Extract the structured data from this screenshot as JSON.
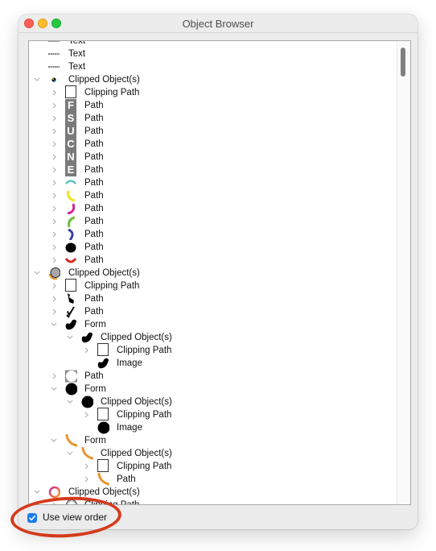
{
  "window": {
    "title": "Object Browser"
  },
  "tree": [
    {
      "level": 0,
      "expander": "none",
      "icon": "text-dash-icon",
      "label": "Text",
      "partial": true
    },
    {
      "level": 0,
      "expander": "none",
      "icon": "text-dash-icon",
      "label": "Text"
    },
    {
      "level": 0,
      "expander": "none",
      "icon": "text-dash-icon",
      "label": "Text"
    },
    {
      "level": 0,
      "expander": "expanded",
      "icon": "colored-dot-icon",
      "label": "Clipped Object(s)"
    },
    {
      "level": 1,
      "expander": "collapsed",
      "icon": "clipping-rect-icon",
      "label": "Clipping Path"
    },
    {
      "level": 1,
      "expander": "collapsed",
      "icon": "letter-f-icon",
      "letter": "F",
      "label": "Path"
    },
    {
      "level": 1,
      "expander": "collapsed",
      "icon": "letter-s-icon",
      "letter": "S",
      "label": "Path"
    },
    {
      "level": 1,
      "expander": "collapsed",
      "icon": "letter-u-icon",
      "letter": "U",
      "label": "Path"
    },
    {
      "level": 1,
      "expander": "collapsed",
      "icon": "letter-c-icon",
      "letter": "C",
      "label": "Path"
    },
    {
      "level": 1,
      "expander": "collapsed",
      "icon": "letter-n-icon",
      "letter": "N",
      "label": "Path"
    },
    {
      "level": 1,
      "expander": "collapsed",
      "icon": "letter-e-icon",
      "letter": "E",
      "label": "Path"
    },
    {
      "level": 1,
      "expander": "collapsed",
      "icon": "arc-teal-icon",
      "color": "#5bc4c0",
      "label": "Path"
    },
    {
      "level": 1,
      "expander": "collapsed",
      "icon": "arc-yellow-icon",
      "color": "#f2e21c",
      "label": "Path"
    },
    {
      "level": 1,
      "expander": "collapsed",
      "icon": "arc-magenta-icon",
      "color": "#d0249a",
      "label": "Path"
    },
    {
      "level": 1,
      "expander": "collapsed",
      "icon": "arc-green-icon",
      "color": "#6cbf3c",
      "label": "Path"
    },
    {
      "level": 1,
      "expander": "collapsed",
      "icon": "arc-blue-icon",
      "color": "#3a3f9e",
      "label": "Path"
    },
    {
      "level": 1,
      "expander": "collapsed",
      "icon": "black-blob-icon",
      "label": "Path"
    },
    {
      "level": 1,
      "expander": "collapsed",
      "icon": "arc-red-icon",
      "color": "#d42a2a",
      "label": "Path"
    },
    {
      "level": 0,
      "expander": "expanded",
      "icon": "gray-circle-icon",
      "label": "Clipped Object(s)"
    },
    {
      "level": 1,
      "expander": "collapsed",
      "icon": "clipping-rect-icon",
      "label": "Clipping Path"
    },
    {
      "level": 1,
      "expander": "collapsed",
      "icon": "brush-stroke-icon",
      "label": "Path"
    },
    {
      "level": 1,
      "expander": "collapsed",
      "icon": "check-stroke-icon",
      "label": "Path"
    },
    {
      "level": 1,
      "expander": "expanded",
      "icon": "brush-blob-icon",
      "label": "Form"
    },
    {
      "level": 2,
      "expander": "expanded",
      "icon": "brush-blob-icon",
      "label": "Clipped Object(s)"
    },
    {
      "level": 3,
      "expander": "collapsed",
      "icon": "clipping-rect-icon",
      "label": "Clipping Path"
    },
    {
      "level": 3,
      "expander": "none",
      "icon": "brush-blob-icon",
      "label": "Image"
    },
    {
      "level": 1,
      "expander": "collapsed",
      "icon": "white-circle-icon",
      "label": "Path"
    },
    {
      "level": 1,
      "expander": "expanded",
      "icon": "black-circle-icon",
      "label": "Form"
    },
    {
      "level": 2,
      "expander": "expanded",
      "icon": "black-circle-icon",
      "label": "Clipped Object(s)"
    },
    {
      "level": 3,
      "expander": "collapsed",
      "icon": "clipping-rect-icon",
      "label": "Clipping Path"
    },
    {
      "level": 3,
      "expander": "none",
      "icon": "black-circle-icon",
      "label": "Image"
    },
    {
      "level": 1,
      "expander": "expanded",
      "icon": "arc-orange-icon",
      "color": "#e8962e",
      "label": "Form"
    },
    {
      "level": 2,
      "expander": "expanded",
      "icon": "arc-orange-icon",
      "color": "#e8962e",
      "label": "Clipped Object(s)"
    },
    {
      "level": 3,
      "expander": "collapsed",
      "icon": "clipping-rect-icon",
      "label": "Clipping Path"
    },
    {
      "level": 3,
      "expander": "collapsed",
      "icon": "arc-orange-icon",
      "color": "#e8962e",
      "label": "Path"
    },
    {
      "level": 0,
      "expander": "expanded",
      "icon": "gradient-ring-icon",
      "label": "Clipped Object(s)"
    },
    {
      "level": 1,
      "expander": "collapsed",
      "icon": "outline-circle-icon",
      "label": "Clipping Path",
      "partial": true
    }
  ],
  "footer": {
    "use_view_order_label": "Use view order",
    "use_view_order_checked": true
  },
  "colors": {
    "accent": "#1a7cf5",
    "annotation": "#d53a1c",
    "close": "#fe5f57",
    "minimize": "#febc2e",
    "maximize": "#28c840"
  }
}
